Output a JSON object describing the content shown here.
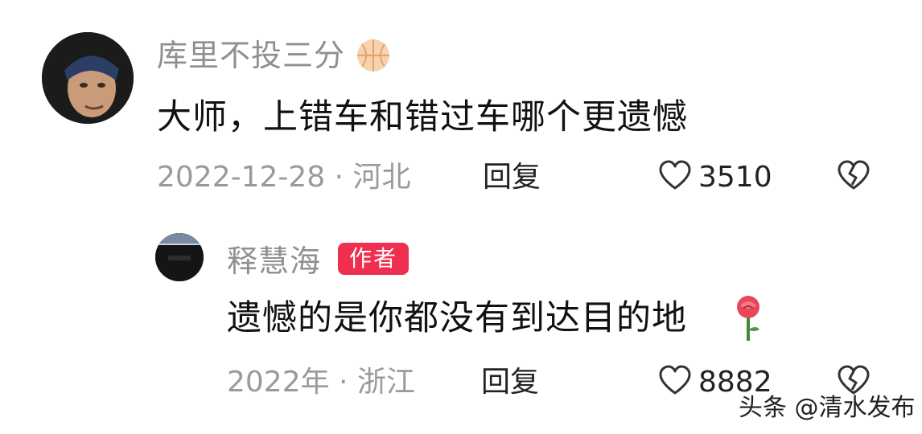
{
  "comments": [
    {
      "username": "库里不投三分",
      "username_icon": "basketball-icon",
      "text": "大师，上错车和错过车哪个更遗憾",
      "date_location": "2022-12-28 · 河北",
      "reply_label": "回复",
      "like_count": "3510",
      "replies": [
        {
          "username": "释慧海",
          "badge": "作者",
          "text": "遗憾的是你都没有到达目的地",
          "text_emoji": "rose-icon",
          "date_location": "2022年 · 浙江",
          "reply_label": "回复",
          "like_count": "8882"
        }
      ]
    }
  ],
  "watermark": "头条 @清水发布",
  "colors": {
    "badge": "#f02f4f",
    "muted_text": "#8f8f8f",
    "primary_text": "#111111"
  }
}
